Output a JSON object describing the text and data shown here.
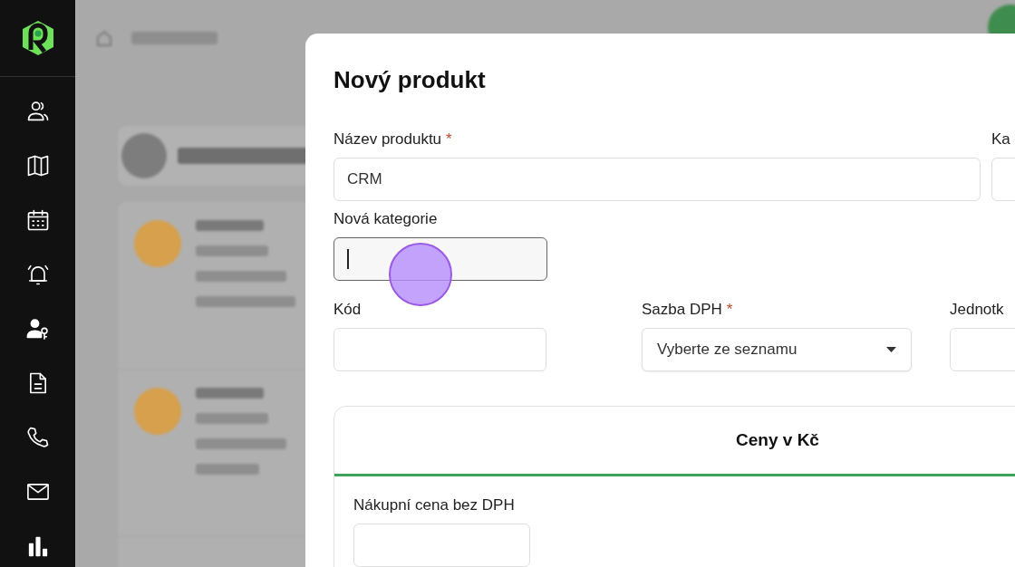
{
  "sidebar": {
    "items": [
      {
        "kind": "contacts"
      },
      {
        "kind": "map"
      },
      {
        "kind": "calendar"
      },
      {
        "kind": "alarm"
      },
      {
        "kind": "user-key"
      },
      {
        "kind": "document"
      },
      {
        "kind": "phone"
      },
      {
        "kind": "mail"
      },
      {
        "kind": "chart"
      }
    ]
  },
  "modal": {
    "title": "Nový produkt",
    "name_field": {
      "label": "Název produktu",
      "required_mark": "*",
      "value": "CRM"
    },
    "category_field": {
      "label": "Ka"
    },
    "new_category_field": {
      "label": "Nová kategorie",
      "focused": true
    },
    "code_field": {
      "label": "Kód"
    },
    "vat_field": {
      "label": "Sazba DPH",
      "required_mark": "*",
      "placeholder": "Vyberte ze seznamu"
    },
    "unit_field": {
      "label": "Jednotk"
    },
    "prices": {
      "title": "Ceny v Kč",
      "purchase_field": {
        "label": "Nákupní cena bez DPH"
      }
    }
  }
}
